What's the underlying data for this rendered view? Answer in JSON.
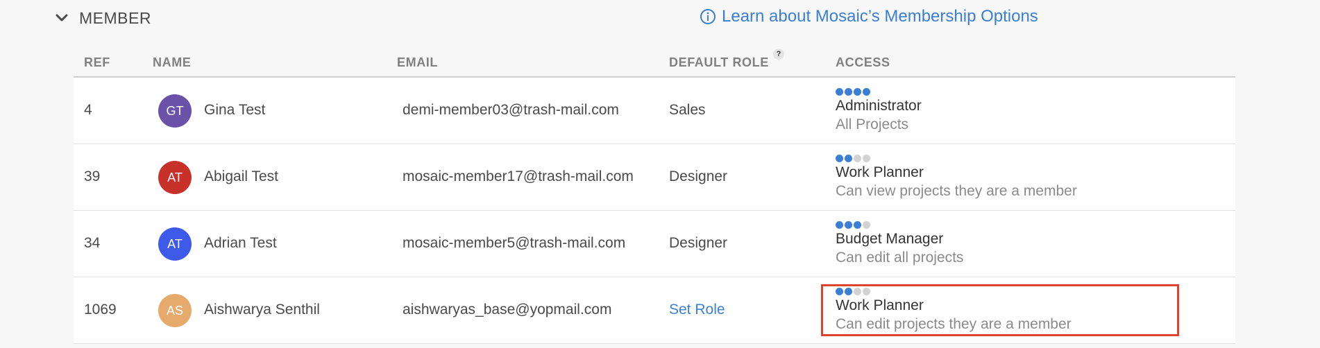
{
  "section": {
    "title": "MEMBER",
    "learn_link": "Learn about Mosaic’s Membership Options"
  },
  "columns": {
    "ref": "REF",
    "name": "NAME",
    "email": "EMAIL",
    "default_role": "DEFAULT ROLE",
    "access": "ACCESS",
    "help": "?"
  },
  "members": [
    {
      "ref": "4",
      "initials": "GT",
      "avatar_color": "#6b52a8",
      "name": "Gina Test",
      "email": "demi-member03@trash-mail.com",
      "role": "Sales",
      "role_is_link": false,
      "access_level": 4,
      "access_title": "Administrator",
      "access_desc": "All Projects"
    },
    {
      "ref": "39",
      "initials": "AT",
      "avatar_color": "#c8302a",
      "name": "Abigail Test",
      "email": "mosaic-member17@trash-mail.com",
      "role": "Designer",
      "role_is_link": false,
      "access_level": 2,
      "access_title": "Work Planner",
      "access_desc": "Can view projects they are a member"
    },
    {
      "ref": "34",
      "initials": "AT",
      "avatar_color": "#3e5ae8",
      "name": "Adrian Test",
      "email": "mosaic-member5@trash-mail.com",
      "role": "Designer",
      "role_is_link": false,
      "access_level": 3,
      "access_title": "Budget Manager",
      "access_desc": "Can edit all projects"
    },
    {
      "ref": "1069",
      "initials": "AS",
      "avatar_color": "#e6aa6c",
      "name": "Aishwarya Senthil",
      "email": "aishwaryas_base@yopmail.com",
      "role": "Set Role",
      "role_is_link": true,
      "access_level": 2,
      "access_title": "Work Planner",
      "access_desc": "Can edit projects they are a member"
    }
  ],
  "colors": {
    "accent": "#3a7fd5",
    "highlight": "#e0432d",
    "dot_off": "#d2d2d2"
  }
}
